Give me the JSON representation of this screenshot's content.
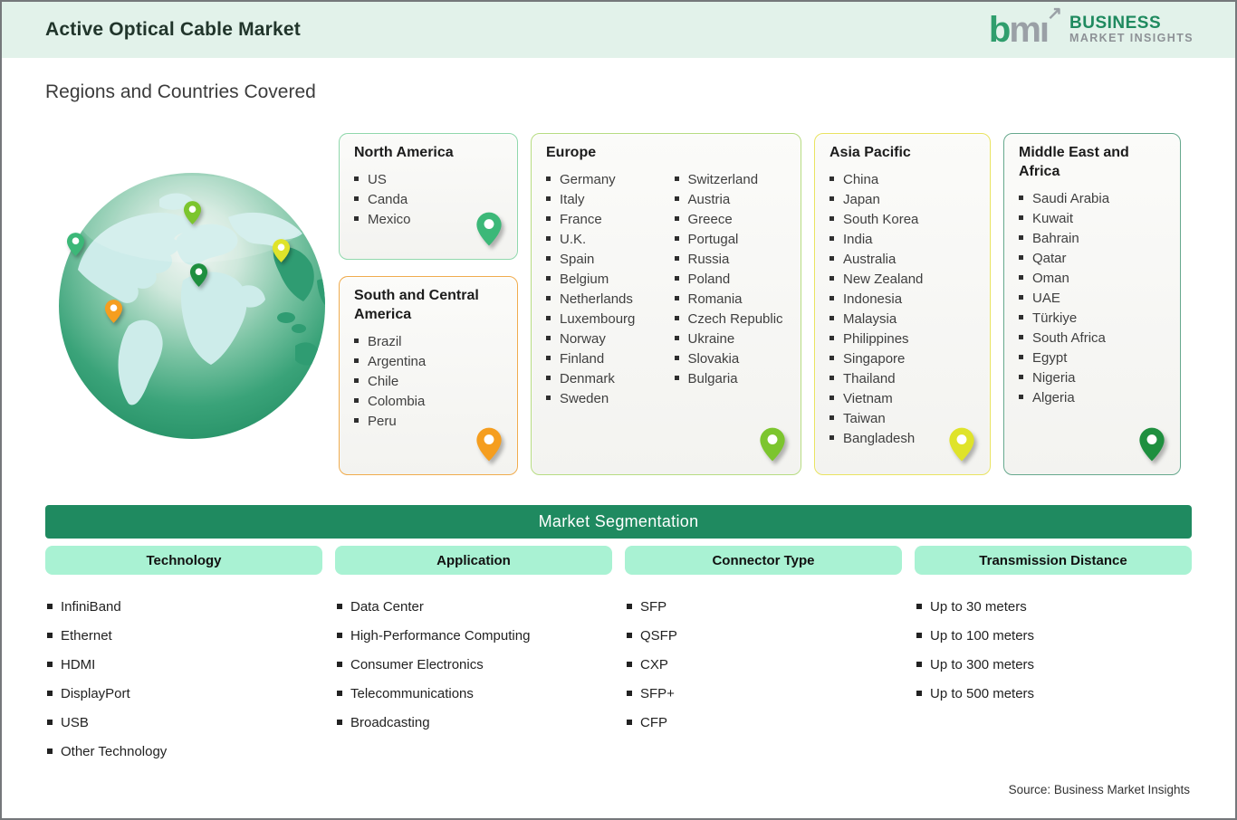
{
  "header": {
    "title": "Active Optical Cable Market",
    "logo": {
      "mark_b": "b",
      "mark_m": "m",
      "mark_i": "ı",
      "arrow": "↗",
      "line1": "BUSINESS",
      "line2": "MARKET INSIGHTS"
    }
  },
  "section_title": "Regions and Countries Covered",
  "regions": [
    {
      "name": "North America",
      "countries": [
        "US",
        "Canda",
        "Mexico"
      ],
      "border_color": "#90d8ac",
      "pin_color": "#3cb878",
      "two_columns": false
    },
    {
      "name": "South and Central America",
      "countries": [
        "Brazil",
        "Argentina",
        "Chile",
        "Colombia",
        "Peru"
      ],
      "border_color": "#f0ac4e",
      "pin_color": "#f59e1f",
      "two_columns": false
    },
    {
      "name": "Europe",
      "countries": [
        "Germany",
        "Italy",
        "France",
        "U.K.",
        "Spain",
        "Belgium",
        "Netherlands",
        "Luxembourg",
        "Norway",
        "Finland",
        "Denmark",
        "Sweden",
        "Switzerland",
        "Austria",
        "Greece",
        "Portugal",
        "Russia",
        "Poland",
        "Romania",
        "Czech Republic",
        "Ukraine",
        "Slovakia",
        "Bulgaria"
      ],
      "border_color": "#b7dc82",
      "pin_color": "#7cc52e",
      "two_columns": true
    },
    {
      "name": "Asia Pacific",
      "countries": [
        "China",
        "Japan",
        "South Korea",
        "India",
        "Australia",
        "New Zealand",
        "Indonesia",
        "Malaysia",
        "Philippines",
        "Singapore",
        "Thailand",
        "Vietnam",
        "Taiwan",
        "Bangladesh"
      ],
      "border_color": "#e9e361",
      "pin_color": "#dfe32a",
      "two_columns": false
    },
    {
      "name": "Middle East and Africa",
      "countries": [
        "Saudi Arabia",
        "Kuwait",
        "Bahrain",
        "Qatar",
        "Oman",
        "UAE",
        "Türkiye",
        "South Africa",
        "Egypt",
        "Nigeria",
        "Algeria"
      ],
      "border_color": "#66a88d",
      "pin_color": "#1f8f3f",
      "two_columns": false
    }
  ],
  "globe_pins": [
    {
      "location": "north-america",
      "color": "#3cb878"
    },
    {
      "location": "europe",
      "color": "#7cc52e"
    },
    {
      "location": "asia-pacific",
      "color": "#dfe32a"
    },
    {
      "location": "middle-east-africa",
      "color": "#1f8f3f"
    },
    {
      "location": "south-america",
      "color": "#f59e1f"
    }
  ],
  "segmentation": {
    "title": "Market Segmentation",
    "columns": [
      {
        "header": "Technology",
        "items": [
          "InfiniBand",
          "Ethernet",
          "HDMI",
          "DisplayPort",
          "USB",
          "Other Technology"
        ]
      },
      {
        "header": "Application",
        "items": [
          "Data Center",
          "High-Performance Computing",
          "Consumer Electronics",
          "Telecommunications",
          "Broadcasting"
        ]
      },
      {
        "header": "Connector Type",
        "items": [
          "SFP",
          "QSFP",
          "CXP",
          "SFP+",
          "CFP"
        ]
      },
      {
        "header": "Transmission Distance",
        "items": [
          "Up to 30 meters",
          "Up to 100 meters",
          "Up to 300 meters",
          "Up to 500 meters"
        ]
      }
    ]
  },
  "source": "Source: Business Market Insights",
  "colors": {
    "header_bg": "#e2f2ea",
    "brand_green": "#1f8a60",
    "seg_bar_bg": "#1f8a60",
    "pill_bg": "#a9f2d3",
    "card_bg": "#f6f6f4",
    "logo_gray": "#9aa0a6"
  }
}
